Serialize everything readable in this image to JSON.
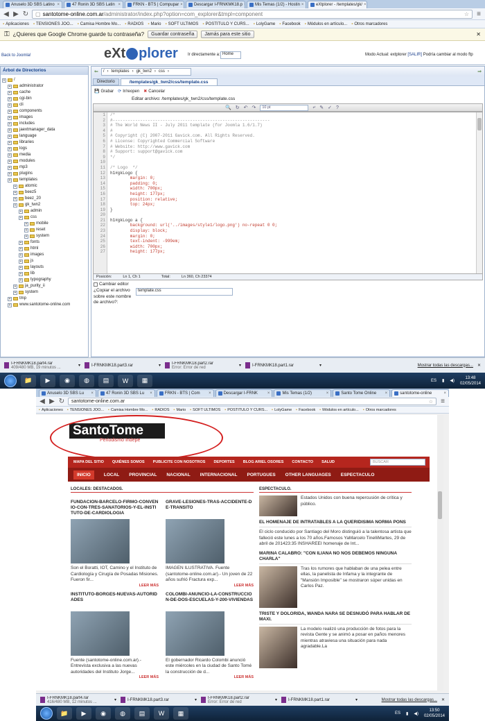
{
  "top": {
    "tabs": [
      "Anuselo 3D SBS Latino",
      "47 Ronin 3D SBS Latin",
      "FRKN - BTS | Compupar",
      "Descargar I-FRNKMK18.p",
      "Mis Temas (1/2) - Hostin",
      "eXtplorer - /templates/gk/"
    ],
    "url_host": "santotome-online.com.ar",
    "url_path": "/administrator/index.php?option=com_explorer&tmpl=component",
    "bookmarks": [
      "Aplicaciones",
      "TENSIONES JOO...",
      "Camisa Hombre Mo...",
      "RADIOS",
      "Mario",
      "SOFT ULTIMOS",
      "POSTITULO Y CURS...",
      "LolyGame",
      "Facebook",
      "Módulos en artículo...",
      "Otros marcadores"
    ],
    "infobar": {
      "question": "¿Quieres que Google Chrome guarde tu contraseña?",
      "save": "Guardar contraseña",
      "never": "Jamás para este sitio"
    },
    "app": {
      "back": "Back to Joomla!",
      "logo_a": "eXt",
      "logo_b": "plorer",
      "goto_label": "Ir directamente a:",
      "goto_value": "Home",
      "mode": "Modo Actual: extplorer",
      "mode_link": "[SALIR]",
      "mode_tail": "Podría cambiar al modo ftp"
    },
    "tree": {
      "title": "Árbol de Directorios",
      "items": [
        {
          "l": "/",
          "d": 0
        },
        {
          "l": "administrator",
          "d": 1
        },
        {
          "l": "cache",
          "d": 1
        },
        {
          "l": "cgi-bin",
          "d": 1
        },
        {
          "l": "cli",
          "d": 1
        },
        {
          "l": "components",
          "d": 1
        },
        {
          "l": "images",
          "d": 1
        },
        {
          "l": "includes",
          "d": 1
        },
        {
          "l": "jaextmanager_data",
          "d": 1
        },
        {
          "l": "language",
          "d": 1
        },
        {
          "l": "libraries",
          "d": 1
        },
        {
          "l": "logs",
          "d": 1
        },
        {
          "l": "media",
          "d": 1
        },
        {
          "l": "modules",
          "d": 1
        },
        {
          "l": "mp3",
          "d": 1
        },
        {
          "l": "plugins",
          "d": 1
        },
        {
          "l": "templates",
          "d": 1
        },
        {
          "l": "atomic",
          "d": 2
        },
        {
          "l": "beez5",
          "d": 2
        },
        {
          "l": "beez_20",
          "d": 2
        },
        {
          "l": "gk_twn2",
          "d": 2
        },
        {
          "l": "admin",
          "d": 3
        },
        {
          "l": "css",
          "d": 3
        },
        {
          "l": "mobile",
          "d": 4
        },
        {
          "l": "reset",
          "d": 4
        },
        {
          "l": "system",
          "d": 4
        },
        {
          "l": "fonts",
          "d": 3
        },
        {
          "l": "html",
          "d": 3
        },
        {
          "l": "images",
          "d": 3
        },
        {
          "l": "js",
          "d": 3
        },
        {
          "l": "layouts",
          "d": 3
        },
        {
          "l": "lib",
          "d": 3
        },
        {
          "l": "typography",
          "d": 3
        },
        {
          "l": "ja_purity_ii",
          "d": 2
        },
        {
          "l": "system",
          "d": 2
        },
        {
          "l": "tmp",
          "d": 1
        },
        {
          "l": "www.santotome-online.com",
          "d": 1
        }
      ]
    },
    "path_crumbs": [
      "/",
      "templates",
      "gk_twn2",
      "css"
    ],
    "dir_tab": "Directorio",
    "file_tab": "/templates/gk_twn2/css/template.css",
    "actions": [
      "Grabar",
      "Ir/reopen",
      "Cancelar"
    ],
    "edit_label": "Editar archivo: /templates/gk_twn2/css/template.css",
    "fontsize": "10 pt",
    "code": [
      {
        "n": "1",
        "t": "/*",
        "cls": "c"
      },
      {
        "n": "2",
        "t": "#---------------------------------------------------------------",
        "cls": "c"
      },
      {
        "n": "3",
        "t": "# The World News II - July 2011 template (for Joomla 1.6/1.7)",
        "cls": "c"
      },
      {
        "n": "4",
        "t": "#",
        "cls": "c"
      },
      {
        "n": "5",
        "t": "# Copyright (C) 2007-2011 Gavick.com. All Rights Reserved.",
        "cls": "c"
      },
      {
        "n": "6",
        "t": "# License: Copyrighted Commercial Software",
        "cls": "c"
      },
      {
        "n": "7",
        "t": "# Website: http://www.gavick.com",
        "cls": "c"
      },
      {
        "n": "8",
        "t": "# Support: support@gavick.com",
        "cls": "c"
      },
      {
        "n": "9",
        "t": "*/",
        "cls": "c"
      },
      {
        "n": "10",
        "t": "",
        "cls": "k"
      },
      {
        "n": "11",
        "t": "/* Logo  */",
        "cls": "c"
      },
      {
        "n": "12",
        "t": "h1#gkLogo {",
        "cls": "k"
      },
      {
        "n": "13",
        "t": "        margin: 0;",
        "cls": "p"
      },
      {
        "n": "14",
        "t": "        padding: 0;",
        "cls": "p"
      },
      {
        "n": "15",
        "t": "        width: 700px;",
        "cls": "p"
      },
      {
        "n": "16",
        "t": "        height: 177px;",
        "cls": "p"
      },
      {
        "n": "17",
        "t": "        position: relative;",
        "cls": "p"
      },
      {
        "n": "18",
        "t": "        top: 24px;",
        "cls": "p"
      },
      {
        "n": "19",
        "t": "}",
        "cls": "k"
      },
      {
        "n": "20",
        "t": "",
        "cls": "k"
      },
      {
        "n": "21",
        "t": "h1#gkLogo a {",
        "cls": "k"
      },
      {
        "n": "22",
        "t": "        background: url('../images/style1/logo.png') no-repeat 0 0;",
        "cls": "p"
      },
      {
        "n": "23",
        "t": "        display: block;",
        "cls": "p"
      },
      {
        "n": "24",
        "t": "        margin: 0;",
        "cls": "p"
      },
      {
        "n": "25",
        "t": "        text-indent: -999em;",
        "cls": "p"
      },
      {
        "n": "26",
        "t": "        width: 700px;",
        "cls": "p"
      },
      {
        "n": "27",
        "t": "        height: 177px;",
        "cls": "p"
      }
    ],
    "status": {
      "pos": "Posición:",
      "ln": "Ln 1, Ch 1",
      "total": "Total:",
      "total_val": "Ln 360, Ch 23374"
    },
    "change_editor": "Cambiar editor",
    "copy_label": "¿Copiar el archivo sobre este nombre de archivo?:",
    "copy_value": "template.css",
    "downloads": [
      {
        "name": "I-FRNKMK18.part4.rar",
        "sub": "409/480 MB, 19 minutos ..."
      },
      {
        "name": "I-FRNKMK18.part3.rar",
        "sub": ""
      },
      {
        "name": "I-FRNKMK18.part2.rar",
        "sub": "Error: Error de red"
      },
      {
        "name": "I-FRNKMK18.part1.rar",
        "sub": ""
      }
    ],
    "show_all": "Mostrar todas las descargas...",
    "tray": {
      "lang": "ES",
      "time": "13:48",
      "date": "02/05/2014"
    }
  },
  "bottom": {
    "tabs": [
      "Anuselo 3D SBS Lu",
      "47 Ronin 3D SBS Lu",
      "FRKN - BTS | Com",
      "Descargar I-FRNK",
      "Mis Temas (1/2)",
      "Santo Tome Online",
      "santotome-online"
    ],
    "url": "santotome-online.com.ar",
    "logo_main": "SantoTome",
    "logo_sub": "Periodismo Indepe",
    "nav1": [
      "MAPA DEL SITIO",
      "QUIÉNES SOMOS",
      "PUBLICITE CON NOSOTROS",
      "DEPORTES",
      "BLOG ARIEL OSORES",
      "CONTACTO",
      "SALUD"
    ],
    "search_ph": "BUSCAR",
    "nav2": [
      "INICIO",
      "LOCAL",
      "PROVINCIAL",
      "NACIONAL",
      "INTERNACIONAL",
      "PORTUGUES",
      "OTHER LANGUAGES",
      "ESPECTACULO"
    ],
    "sec_local": "LOCALES: DESTACADOS.",
    "sec_esp": "ESPECTACULO.",
    "local": [
      {
        "title": "FUNDACION-BARCELO-FIRMO-CONVENIO-CON-TRES-SANATORIOS-Y-EL-INSTITUTO-DE-CARDIOLOGIA",
        "text": "Son el Boratti, IOT, Camino y el Instituto de Cardiología y Cirugía de Posadas Misiones. Fueron fir...",
        "more": "LEER MÁS"
      },
      {
        "title": "GRAVE-LESIONES-TRAS-ACCIDENTE-DE-TRANSITO",
        "text": "IMAGEN ILUSTRATIVA. Fuente (santotome-online.com.ar).- Un joven de 22 años sufrió Fractura exp...",
        "more": "LEER MÁS"
      },
      {
        "title": "INSTITUTO-BORGES-NUEVAS-AUTORIDADES",
        "text": "Fuente (santotome-online.com.ar).- Entrevista exclusiva a las nuevas autoridades del Instituto Jorge...",
        "more": "LEER MÁS"
      },
      {
        "title": "COLOMBI-ANUNCIO-LA-CONSTRUCCION-DE-DOS-ESCUELAS-Y-200-VIVIENDAS",
        "text": "El gobernador Ricardo Colombi anunció este miércoles en la ciudad de Santo Tomé la construcción de d...",
        "more": "LEER MÁS"
      }
    ],
    "esp": [
      {
        "title": "",
        "text": "Estados Unidos con buena repercusión de crítica y público."
      },
      {
        "title": "EL HOMENAJE DE INTRATABLES A LA QUERIDISIMA NORMA PONS",
        "text": "El ciclo conducido por Santiago del Moro distinguió a la talentosa artista que falleció este lunes a los 70 años.Famosos YaMarcelo TinelliMartes, 29 de abril de 201423:35 INSHAREEI homenaje de Int..."
      },
      {
        "title": "MARINA CALABRO: \"CON ILIANA NO NOS DEBEMOS NINGUNA CHARLA\"",
        "text": "Tras los rumores que hablaban de una pelea entre ellas, la panelista de Infama y la integrante de \"Mansión Imposible\" se mostraron súper unidas en Carlos Paz."
      },
      {
        "title": "TRISTE Y DOLORIDA, WANDA NARA SE DESNUDÓ PARA HABLAR DE MAXI.",
        "text": "La modelo realizó una producción de fotos para la revista Gente y se animó a posar en paños menores mientras atraviesa una situación para nada agradable.La"
      }
    ],
    "downloads": [
      {
        "name": "I-FRNKMK18.part4.rar",
        "sub": "416/480 MB, 12 minutos ..."
      },
      {
        "name": "I-FRNKMK18.part3.rar",
        "sub": ""
      },
      {
        "name": "I-FRNKMK18.part2.rar",
        "sub": "Error: Error de red"
      },
      {
        "name": "I-FRNKMK18.part1.rar",
        "sub": ""
      }
    ],
    "show_all": "Mostrar todas las descargas...",
    "tray": {
      "lang": "ES",
      "time": "13:50",
      "date": "02/05/2014"
    }
  }
}
